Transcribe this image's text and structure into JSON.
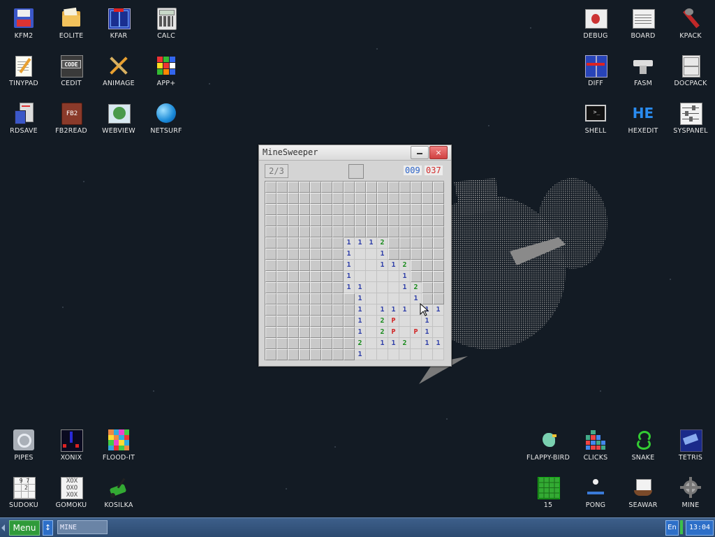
{
  "desktop": {
    "icons_left_top": [
      {
        "label": "KFM2",
        "icon": "floppy-icon"
      },
      {
        "label": "EOLITE",
        "icon": "folder-icon"
      },
      {
        "label": "KFAR",
        "icon": "kfar-icon"
      },
      {
        "label": "CALC",
        "icon": "calculator-icon"
      },
      {
        "label": "TINYPAD",
        "icon": "notepad-icon"
      },
      {
        "label": "CEDIT",
        "icon": "code-editor-icon"
      },
      {
        "label": "ANIMAGE",
        "icon": "pencil-ruler-icon"
      },
      {
        "label": "APP+",
        "icon": "rubiks-cube-icon"
      },
      {
        "label": "RDSAVE",
        "icon": "rdsave-icon"
      },
      {
        "label": "FB2READ",
        "icon": "book-icon"
      },
      {
        "label": "WEBVIEW",
        "icon": "webview-icon"
      },
      {
        "label": "NETSURF",
        "icon": "globe-icon"
      }
    ],
    "icons_right_top": [
      {
        "label": "DEBUG",
        "icon": "bug-icon"
      },
      {
        "label": "BOARD",
        "icon": "board-icon"
      },
      {
        "label": "KPACK",
        "icon": "wrench-icon"
      },
      {
        "label": "DIFF",
        "icon": "diff-icon"
      },
      {
        "label": "FASM",
        "icon": "anvil-icon"
      },
      {
        "label": "DOCPACK",
        "icon": "cabinet-icon"
      },
      {
        "label": "SHELL",
        "icon": "terminal-icon"
      },
      {
        "label": "HEXEDIT",
        "icon": "hex-icon"
      },
      {
        "label": "SYSPANEL",
        "icon": "sliders-icon"
      }
    ],
    "icons_left_bottom": [
      {
        "label": "PIPES",
        "icon": "pipes-icon"
      },
      {
        "label": "XONIX",
        "icon": "xonix-icon"
      },
      {
        "label": "FLOOD-IT",
        "icon": "flood-it-icon"
      },
      {
        "label": "SUDOKU",
        "icon": "sudoku-icon"
      },
      {
        "label": "GOMOKU",
        "icon": "gomoku-icon"
      },
      {
        "label": "KOSILKA",
        "icon": "lawnmower-icon"
      }
    ],
    "icons_right_bottom": [
      {
        "label": "FLAPPY-BIRD",
        "icon": "bird-icon"
      },
      {
        "label": "CLICKS",
        "icon": "clicks-icon"
      },
      {
        "label": "SNAKE",
        "icon": "snake-icon"
      },
      {
        "label": "TETRIS",
        "icon": "tetris-icon"
      },
      {
        "label": "15",
        "icon": "fifteen-puzzle-icon"
      },
      {
        "label": "PONG",
        "icon": "pong-icon"
      },
      {
        "label": "SEAWAR",
        "icon": "ship-icon"
      },
      {
        "label": "MINE",
        "icon": "mine-icon"
      }
    ]
  },
  "window": {
    "title": "MineSweeper",
    "close_glyph": "×",
    "level": "2/3",
    "flags_counter": "009",
    "time_counter": "037",
    "grid_rows": [
      "cccccccccccccccc",
      "cccccccccccccccc",
      "cccccccccccccccc",
      "cccccccccccccccc",
      "cccccccccccccccc",
      "ccccccc1112ccccc",
      "ccccccc1oo1ccccc",
      "ccccccc1oo112ccc",
      "ccccccc1oooo1ccc",
      "ccccccc11ooo12cc",
      "cccccccc1oooo1cc",
      "cccccccc1o111o11",
      "cccccccc1o2Foo1o",
      "cccccccc1o2FoF1o",
      "cccccccc2o112o11",
      "cccccccc1ooooooo"
    ]
  },
  "taskbar": {
    "menu_label": "Menu",
    "swap_glyph": "↕",
    "task_item": "MINE",
    "language": "En",
    "clock": "13:04"
  }
}
